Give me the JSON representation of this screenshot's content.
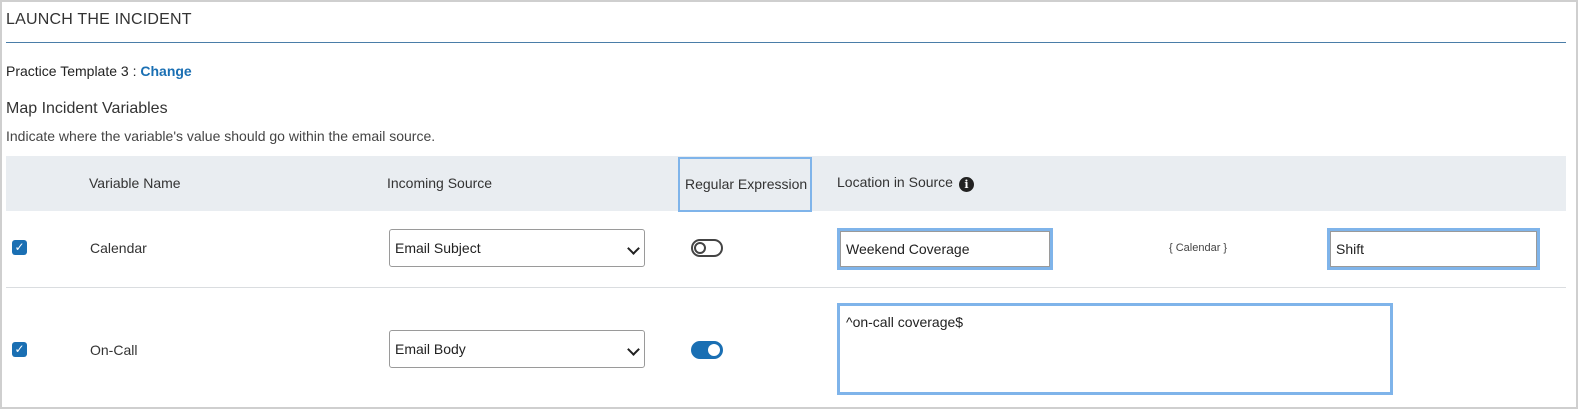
{
  "panel": {
    "title": "LAUNCH THE INCIDENT",
    "template_label": "Practice Template 3 :",
    "change_label": "Change"
  },
  "section": {
    "title": "Map Incident Variables",
    "description": "Indicate where the variable's value should go within the email source."
  },
  "table": {
    "headers": {
      "variable_name": "Variable Name",
      "incoming_source": "Incoming Source",
      "regular_expression": "Regular Expression",
      "location_in_source": "Location in Source"
    },
    "info_icon": "info-icon",
    "rows": [
      {
        "checked": true,
        "variable": "Calendar",
        "source": "Email Subject",
        "regex_enabled": false,
        "location_before": "Weekend Coverage",
        "token": "{ Calendar }",
        "location_after": "Shift"
      },
      {
        "checked": true,
        "variable": "On-Call",
        "source": "Email Body",
        "regex_enabled": true,
        "regex_value": "^on-call coverage$"
      }
    ]
  },
  "colors": {
    "accent": "#1a6fb3",
    "focus_border": "#7fb4ea",
    "header_bg": "#e9edf1",
    "title_rule": "#4a7da8"
  }
}
